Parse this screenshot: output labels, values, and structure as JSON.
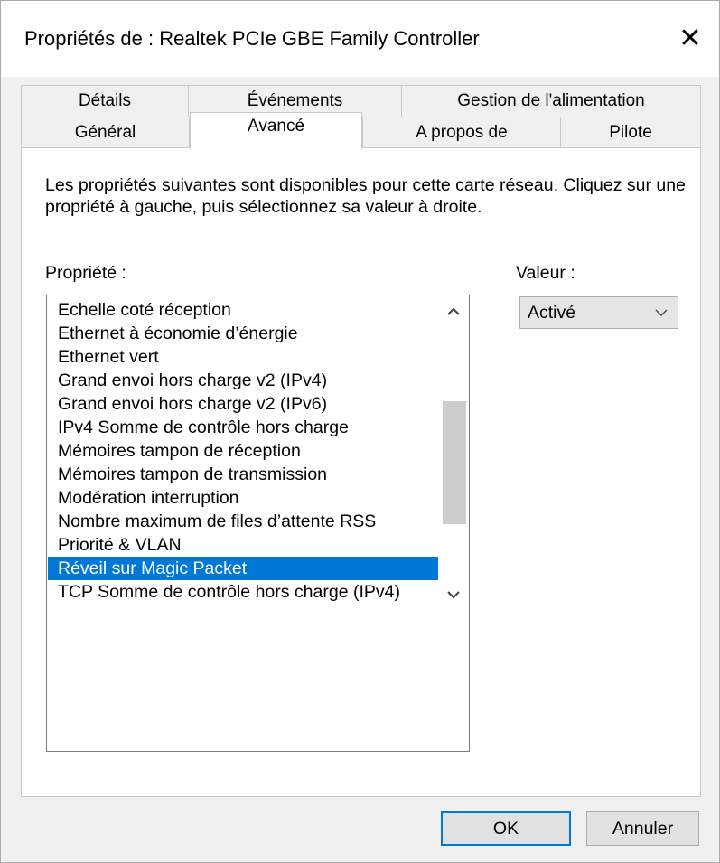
{
  "window": {
    "title": "Propriétés de : Realtek PCIe GBE Family Controller",
    "close_glyph": "✕"
  },
  "tabs": {
    "row1": [
      {
        "label": "Détails"
      },
      {
        "label": "Événements"
      },
      {
        "label": "Gestion de l'alimentation"
      }
    ],
    "row2": [
      {
        "label": "Général"
      },
      {
        "label": "Avancé",
        "active": true
      },
      {
        "label": "A propos de"
      },
      {
        "label": "Pilote"
      }
    ]
  },
  "panel": {
    "description": "Les propriétés suivantes sont disponibles pour cette carte réseau. Cliquez sur une propriété à gauche, puis sélectionnez sa valeur à droite.",
    "property_label": "Propriété :",
    "value_label": "Valeur :",
    "properties": [
      "Echelle coté réception",
      "Ethernet à économie d’énergie",
      "Ethernet vert",
      "Grand envoi hors charge v2 (IPv4)",
      "Grand envoi hors charge v2 (IPv6)",
      "IPv4 Somme de contrôle hors charge",
      "Mémoires tampon de réception",
      "Mémoires tampon de transmission",
      "Modération interruption",
      "Nombre maximum de files d’attente RSS",
      "Priorité & VLAN",
      "Réveil sur Magic Packet",
      "TCP Somme de contrôle hors charge (IPv4)"
    ],
    "selected_property": "Réveil sur Magic Packet",
    "value_selected": "Activé"
  },
  "buttons": {
    "ok": "OK",
    "cancel": "Annuler"
  },
  "icons": {
    "close": "close-icon",
    "scroll_up": "chevron-up-icon",
    "scroll_down": "chevron-down-icon",
    "combo_arrow": "chevron-down-icon"
  },
  "colors": {
    "selection": "#0078d7",
    "default_button_border": "#0078d7",
    "window_bg": "#f0f0f0",
    "panel_bg": "#ffffff"
  }
}
